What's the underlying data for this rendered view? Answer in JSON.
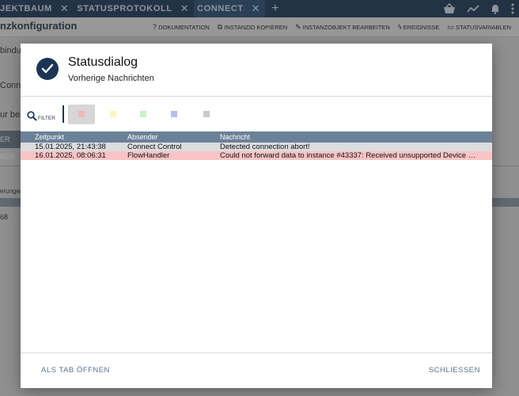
{
  "tabs": [
    {
      "label": "JEKTBAUM",
      "close": "✕"
    },
    {
      "label": "STATUSPROTOKOLL",
      "close": "✕"
    },
    {
      "label": "CONNECT",
      "close": "✕"
    }
  ],
  "add_tab": "+",
  "app": {
    "title": "nzkonfiguration",
    "actions": [
      {
        "icon": "?",
        "label": "DOKUMENTATION"
      },
      {
        "icon": "⧉",
        "label": "INSTANZID KOPIEREN"
      },
      {
        "icon": "✎",
        "label": "INSTANZOBJEKT BEARBEITEN"
      },
      {
        "icon": "ϟ",
        "label": "EREIGNISSE"
      },
      {
        "icon": "▭",
        "label": "STATUSVARIABLEN"
      }
    ],
    "fragments": [
      "bindu",
      "Conn",
      "ur bei",
      "ER REA",
      "erungen",
      "68"
    ]
  },
  "dialog": {
    "title": "Statusdialog",
    "subtitle": "Vorherige Nachrichten",
    "filter_label": "FILTER",
    "filter_colors": [
      "#f4b6b6",
      "#fbf6bd",
      "#c7f3c3",
      "#b8bdf0",
      "#c9c9c9"
    ],
    "columns": [
      "Zeitpunkt",
      "Absender",
      "Nachricht"
    ],
    "rows": [
      {
        "time": "15.01.2025, 21:43:38",
        "sender": "Connect Control",
        "message": "Detected connection abort!"
      },
      {
        "time": "16.01.2025, 08:06:31",
        "sender": "FlowHandler",
        "message": "Could not forward data to instance #43337: Received unsupported Device …"
      }
    ],
    "open_as_tab": "ALS TAB ÖFFNEN",
    "close": "SCHLIESSEN"
  }
}
